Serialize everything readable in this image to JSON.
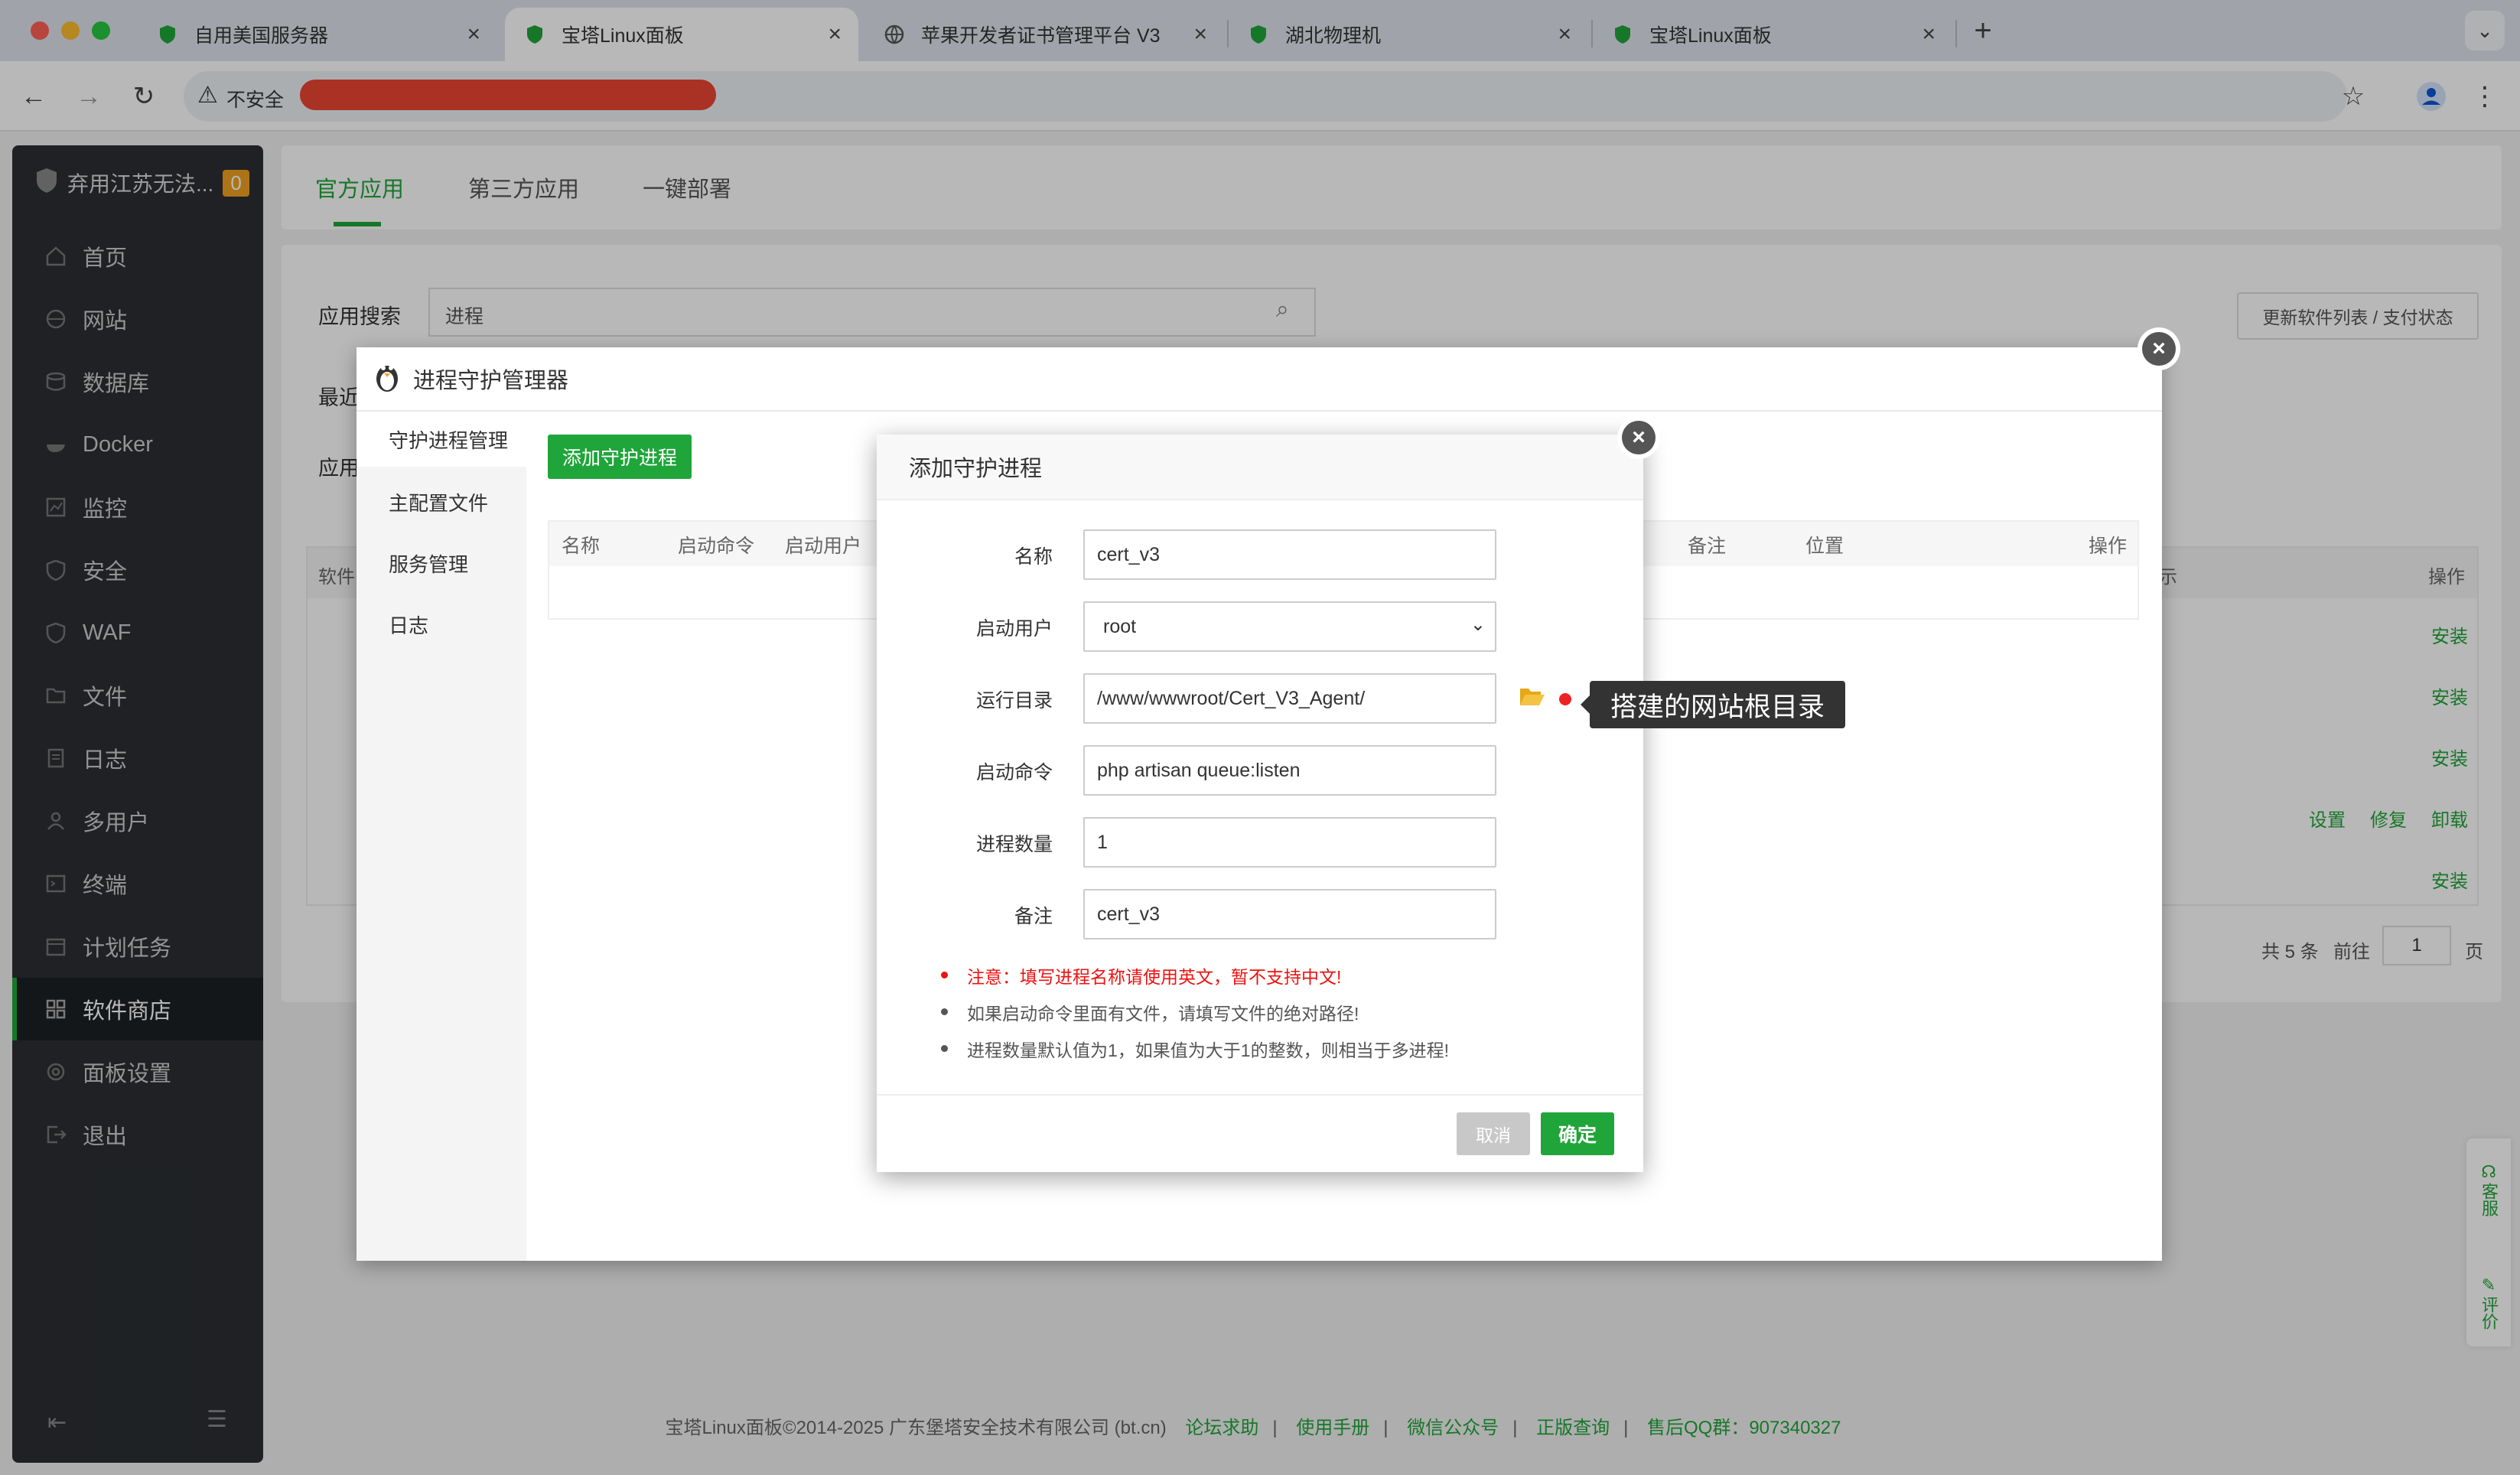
{
  "browser": {
    "tabs": [
      {
        "label": "自用美国服务器",
        "active": false
      },
      {
        "label": "宝塔Linux面板",
        "active": true
      },
      {
        "label": "苹果开发者证书管理平台 V3",
        "active": false
      },
      {
        "label": "湖北物理机",
        "active": false
      },
      {
        "label": "宝塔Linux面板",
        "active": false
      }
    ],
    "security_label": "不安全"
  },
  "sidebar": {
    "server_name": "弃用江苏无法...",
    "badge": "0",
    "items": [
      "首页",
      "网站",
      "数据库",
      "Docker",
      "监控",
      "安全",
      "WAF",
      "文件",
      "日志",
      "多用户",
      "终端",
      "计划任务",
      "软件商店",
      "面板设置",
      "退出"
    ],
    "active_index": 12
  },
  "store": {
    "tabs": [
      "官方应用",
      "第三方应用",
      "一键部署"
    ],
    "search_label": "应用搜索",
    "search_value": "进程",
    "update_btn": "更新软件列表 / 支付状态",
    "recent_label": "最近",
    "category_label": "应用",
    "software_label": "软件",
    "ops_label": "操作",
    "display_label": "示",
    "actions": [
      "安装",
      "安装",
      "安装",
      "设置",
      "修复",
      "卸载",
      "安装"
    ],
    "pagination": {
      "total": "共 5 条",
      "goto": "前往",
      "page": "1",
      "unit": "页"
    }
  },
  "process_manager": {
    "title": "进程守护管理器",
    "menu": [
      "守护进程管理",
      "主配置文件",
      "服务管理",
      "日志"
    ],
    "add_btn": "添加守护进程",
    "columns": [
      "名称",
      "启动命令",
      "启动用户",
      "备注",
      "位置",
      "操作"
    ]
  },
  "add_dialog": {
    "title": "添加守护进程",
    "fields": {
      "name": {
        "label": "名称",
        "value": "cert_v3"
      },
      "user": {
        "label": "启动用户",
        "value": "root"
      },
      "dir": {
        "label": "运行目录",
        "value": "/www/wwwroot/Cert_V3_Agent/"
      },
      "cmd": {
        "label": "启动命令",
        "value": "php artisan queue:listen"
      },
      "count": {
        "label": "进程数量",
        "value": "1"
      },
      "remark": {
        "label": "备注",
        "value": "cert_v3"
      }
    },
    "notes": [
      "注意：填写进程名称请使用英文，暂不支持中文!",
      "如果启动命令里面有文件，请填写文件的绝对路径!",
      "进程数量默认值为1，如果值为大于1的整数，则相当于多进程!"
    ],
    "cancel": "取消",
    "confirm": "确定"
  },
  "tooltip": "搭建的网站根目录",
  "floaty": {
    "service": "客服",
    "review": "评价"
  },
  "footer": {
    "copyright": "宝塔Linux面板©2014-2025 广东堡塔安全技术有限公司 (bt.cn)",
    "links": [
      "论坛求助",
      "使用手册",
      "微信公众号",
      "正版查询"
    ],
    "qq": "售后QQ群：907340327"
  },
  "colors": {
    "accent": "#20a53a",
    "danger": "#ee1111",
    "sidebar_bg": "#2b2f33"
  }
}
